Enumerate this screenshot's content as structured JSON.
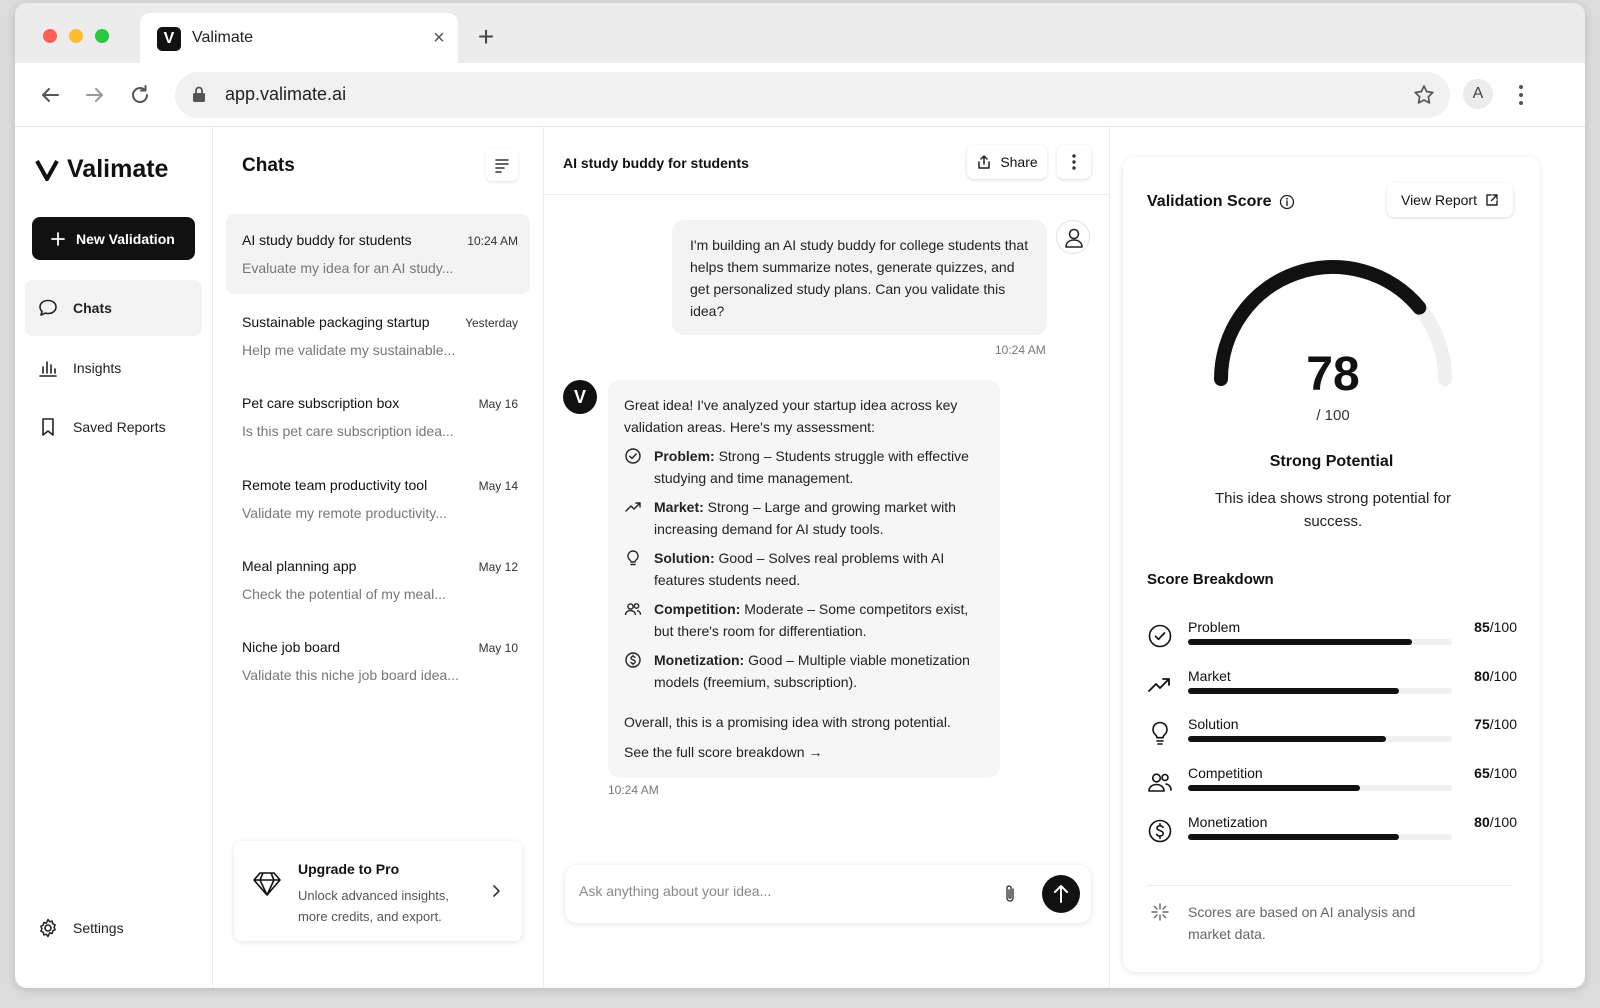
{
  "browser": {
    "tab_title": "Valimate",
    "favicon_letter": "V",
    "url": "app.valimate.ai",
    "profile_letter": "A"
  },
  "sidebar": {
    "logo_text": "Valimate",
    "new_button_label": "New Validation",
    "items": [
      {
        "label": "Chats",
        "icon": "chat-bubble-icon",
        "active": true
      },
      {
        "label": "Insights",
        "icon": "bar-chart-icon",
        "active": false
      },
      {
        "label": "Saved Reports",
        "icon": "bookmark-icon",
        "active": false
      }
    ],
    "settings_label": "Settings"
  },
  "chatlist": {
    "title": "Chats",
    "items": [
      {
        "title": "AI study buddy for students",
        "time": "10:24 AM",
        "preview": "Evaluate my idea for an AI study..."
      },
      {
        "title": "Sustainable packaging startup",
        "time": "Yesterday",
        "preview": "Help me validate my sustainable..."
      },
      {
        "title": "Pet care subscription box",
        "time": "May 16",
        "preview": "Is this pet care subscription idea..."
      },
      {
        "title": "Remote team productivity tool",
        "time": "May 14",
        "preview": "Validate my remote productivity..."
      },
      {
        "title": "Meal planning app",
        "time": "May 12",
        "preview": "Check the potential of my meal..."
      },
      {
        "title": "Niche job board",
        "time": "May 10",
        "preview": "Validate this niche job board idea..."
      }
    ],
    "upgrade": {
      "title": "Upgrade to Pro",
      "description": "Unlock advanced insights, more credits, and export."
    }
  },
  "chat": {
    "title": "AI study buddy for students",
    "share_label": "Share",
    "user_message": "I'm building an AI study buddy for college students that helps them summarize notes, generate quizzes, and get personalized study plans. Can you validate this idea?",
    "user_time": "10:24 AM",
    "bot_avatar_letter": "V",
    "bot_intro": "Great idea! I've analyzed your startup idea across key validation areas. Here's my assessment:",
    "bot_points": [
      {
        "label": "Problem:",
        "text": " Strong – Students struggle with effective studying and time management.",
        "icon": "check-circle-icon"
      },
      {
        "label": "Market:",
        "text": " Strong – Large and growing market with increasing demand for AI study tools.",
        "icon": "trend-up-icon"
      },
      {
        "label": "Solution:",
        "text": " Good – Solves real problems with AI features students need.",
        "icon": "lightbulb-icon"
      },
      {
        "label": "Competition:",
        "text": " Moderate – Some competitors exist, but there's room for differentiation.",
        "icon": "users-icon"
      },
      {
        "label": "Monetization:",
        "text": " Good – Multiple viable monetization models (freemium, subscription).",
        "icon": "dollar-circle-icon"
      }
    ],
    "bot_summary": "Overall, this is a promising idea with strong potential.",
    "bot_link": "See the full score breakdown →",
    "bot_time": "10:24 AM",
    "input_placeholder": "Ask anything about your idea..."
  },
  "score": {
    "title": "Validation Score",
    "view_report_label": "View Report",
    "value": "78",
    "value_number": 78,
    "denominator": "/ 100",
    "rating": "Strong Potential",
    "rating_desc": "This idea shows strong potential for success.",
    "breakdown_title": "Score Breakdown",
    "breakdown": [
      {
        "label": "Problem",
        "score": "85",
        "max": "/100",
        "fraction": 0.85,
        "icon": "check-circle-icon"
      },
      {
        "label": "Market",
        "score": "80",
        "max": "/100",
        "fraction": 0.8,
        "icon": "trend-up-icon"
      },
      {
        "label": "Solution",
        "score": "75",
        "max": "/100",
        "fraction": 0.75,
        "icon": "lightbulb-icon"
      },
      {
        "label": "Competition",
        "score": "65",
        "max": "/100",
        "fraction": 0.65,
        "icon": "users-icon"
      },
      {
        "label": "Monetization",
        "score": "80",
        "max": "/100",
        "fraction": 0.8,
        "icon": "dollar-circle-icon"
      }
    ],
    "note": "Scores are based on AI analysis and market data."
  },
  "colors": {
    "accent": "#111111",
    "track": "#f0f0f0",
    "active_bg": "#f3f3f3"
  }
}
